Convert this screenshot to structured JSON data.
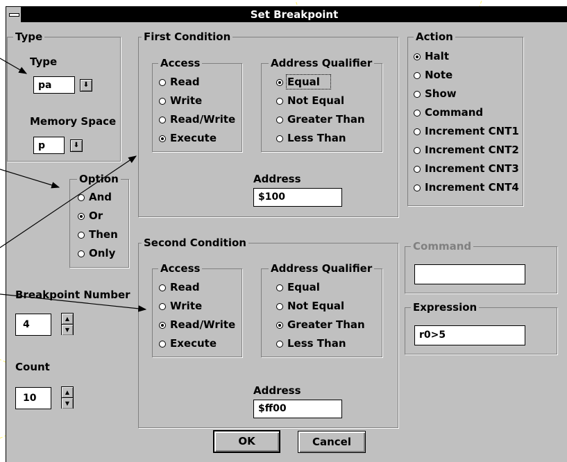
{
  "dialog": {
    "title": "Set Breakpoint"
  },
  "type_group": {
    "legend": "Type",
    "type_label": "Type",
    "type_value": "pa",
    "memory_label": "Memory Space",
    "memory_value": "p"
  },
  "option_group": {
    "legend": "Option",
    "items": [
      {
        "label": "And",
        "checked": false
      },
      {
        "label": "Or",
        "checked": true
      },
      {
        "label": "Then",
        "checked": false
      },
      {
        "label": "Only",
        "checked": false
      }
    ]
  },
  "breakpoint_number": {
    "label": "Breakpoint Number",
    "value": "4"
  },
  "count": {
    "label": "Count",
    "value": "10"
  },
  "first_condition": {
    "legend": "First Condition",
    "access_legend": "Access",
    "access": [
      {
        "label": "Read",
        "checked": false
      },
      {
        "label": "Write",
        "checked": false
      },
      {
        "label": "Read/Write",
        "checked": false
      },
      {
        "label": "Execute",
        "checked": true
      }
    ],
    "qualifier_legend": "Address Qualifier",
    "qualifier": [
      {
        "label": "Equal",
        "checked": true
      },
      {
        "label": "Not Equal",
        "checked": false
      },
      {
        "label": "Greater Than",
        "checked": false
      },
      {
        "label": "Less Than",
        "checked": false
      }
    ],
    "address_label": "Address",
    "address_value": "$100"
  },
  "second_condition": {
    "legend": "Second Condition",
    "access_legend": "Access",
    "access": [
      {
        "label": "Read",
        "checked": false
      },
      {
        "label": "Write",
        "checked": false
      },
      {
        "label": "Read/Write",
        "checked": true
      },
      {
        "label": "Execute",
        "checked": false
      }
    ],
    "qualifier_legend": "Address Qualifier",
    "qualifier": [
      {
        "label": "Equal",
        "checked": false
      },
      {
        "label": "Not Equal",
        "checked": false
      },
      {
        "label": "Greater Than",
        "checked": true
      },
      {
        "label": "Less Than",
        "checked": false
      }
    ],
    "address_label": "Address",
    "address_value": "$ff00"
  },
  "action_group": {
    "legend": "Action",
    "items": [
      {
        "label": "Halt",
        "checked": true
      },
      {
        "label": "Note",
        "checked": false
      },
      {
        "label": "Show",
        "checked": false
      },
      {
        "label": "Command",
        "checked": false
      },
      {
        "label": "Increment CNT1",
        "checked": false
      },
      {
        "label": "Increment CNT2",
        "checked": false
      },
      {
        "label": "Increment CNT3",
        "checked": false
      },
      {
        "label": "Increment CNT4",
        "checked": false
      }
    ]
  },
  "command_group": {
    "legend": "Command",
    "value": ""
  },
  "expression_group": {
    "legend": "Expression",
    "value": "r0>5"
  },
  "buttons": {
    "ok": "OK",
    "cancel": "Cancel"
  },
  "colors": {
    "dialog_bg": "#c0c0c0",
    "titlebar": "#000000",
    "annotation": "#ffff00"
  }
}
